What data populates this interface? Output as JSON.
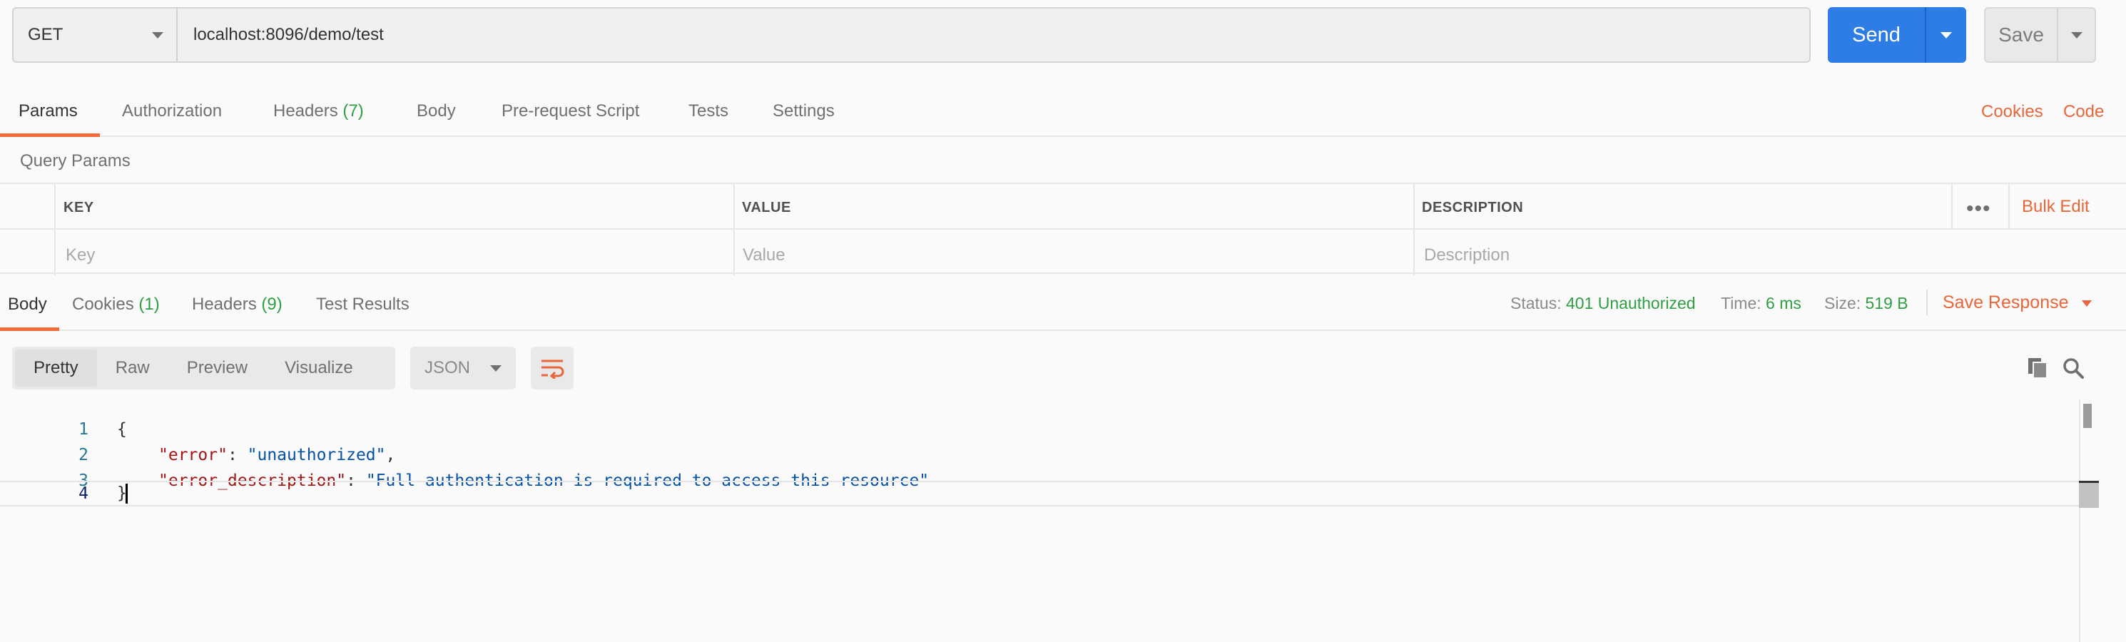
{
  "request": {
    "method": "GET",
    "url": "localhost:8096/demo/test",
    "send_label": "Send",
    "save_label": "Save"
  },
  "request_tabs": {
    "params": "Params",
    "authorization": "Authorization",
    "headers": "Headers",
    "headers_count": "(7)",
    "body": "Body",
    "pre_request": "Pre-request Script",
    "tests": "Tests",
    "settings": "Settings",
    "cookies_link": "Cookies",
    "code_link": "Code",
    "active": "Params"
  },
  "query_params": {
    "title": "Query Params",
    "columns": {
      "key": "KEY",
      "value": "VALUE",
      "description": "DESCRIPTION"
    },
    "placeholders": {
      "key": "Key",
      "value": "Value",
      "description": "Description"
    },
    "bulk_edit": "Bulk Edit"
  },
  "response_tabs": {
    "body": "Body",
    "cookies": "Cookies",
    "cookies_count": "(1)",
    "headers": "Headers",
    "headers_count": "(9)",
    "test_results": "Test Results",
    "active": "Body"
  },
  "response_status": {
    "status_label": "Status:",
    "status_value": "401 Unauthorized",
    "time_label": "Time:",
    "time_value": "6 ms",
    "size_label": "Size:",
    "size_value": "519 B",
    "save_response": "Save Response"
  },
  "response_view": {
    "modes": [
      "Pretty",
      "Raw",
      "Preview",
      "Visualize"
    ],
    "active_mode": "Pretty",
    "format": "JSON"
  },
  "response_body": {
    "line_numbers": [
      "1",
      "2",
      "3",
      "4"
    ],
    "open_brace": "{",
    "close_brace": "}",
    "line2_key": "\"error\"",
    "line2_sep": ": ",
    "line2_value": "\"unauthorized\"",
    "line2_end": ",",
    "line3_key": "\"error_description\"",
    "line3_sep": ": ",
    "line3_value": "\"Full authentication is required to access this resource\""
  },
  "colors": {
    "accent_orange": "#f26b3a",
    "send_blue": "#2e7ce6",
    "status_green": "#2f9e44",
    "json_key": "#a31515",
    "json_string": "#0451a5"
  },
  "icons": {
    "method_dropdown": "chevron-down-icon",
    "wrap": "wrap-lines-icon",
    "copy": "copy-icon",
    "search": "search-icon",
    "more": "more-horizontal-icon"
  }
}
